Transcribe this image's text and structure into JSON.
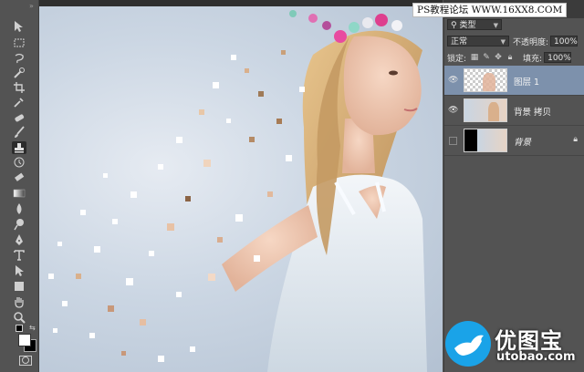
{
  "watermark": "PS教程论坛 WWW.16XX8.COM",
  "layers_panel": {
    "filter_kind": "类型",
    "blend_mode": "正常",
    "opacity_label": "不透明度:",
    "opacity_value": "100%",
    "lock_label": "锁定:",
    "fill_label": "填充:",
    "fill_value": "100%",
    "layers": [
      {
        "name": "图层 1",
        "visible": true,
        "selected": true
      },
      {
        "name": "背景 拷贝",
        "visible": true,
        "selected": false
      },
      {
        "name": "背景",
        "visible": false,
        "selected": false,
        "locked": true
      }
    ]
  },
  "logo": {
    "brand": "优图宝",
    "site": "utobao.com"
  },
  "colors": {
    "panel_bg": "#535353",
    "selected_layer": "#7d91ac",
    "logo_blue": "#1aa3e8"
  },
  "tools": [
    "move-tool",
    "marquee-tool",
    "lasso-tool",
    "quick-select-tool",
    "crop-tool",
    "eyedropper-tool",
    "healing-tool",
    "brush-tool",
    "clone-stamp-tool",
    "history-brush-tool",
    "eraser-tool",
    "gradient-tool",
    "blur-tool",
    "dodge-tool",
    "pen-tool",
    "type-tool",
    "path-select-tool",
    "shape-tool",
    "hand-tool",
    "zoom-tool"
  ]
}
